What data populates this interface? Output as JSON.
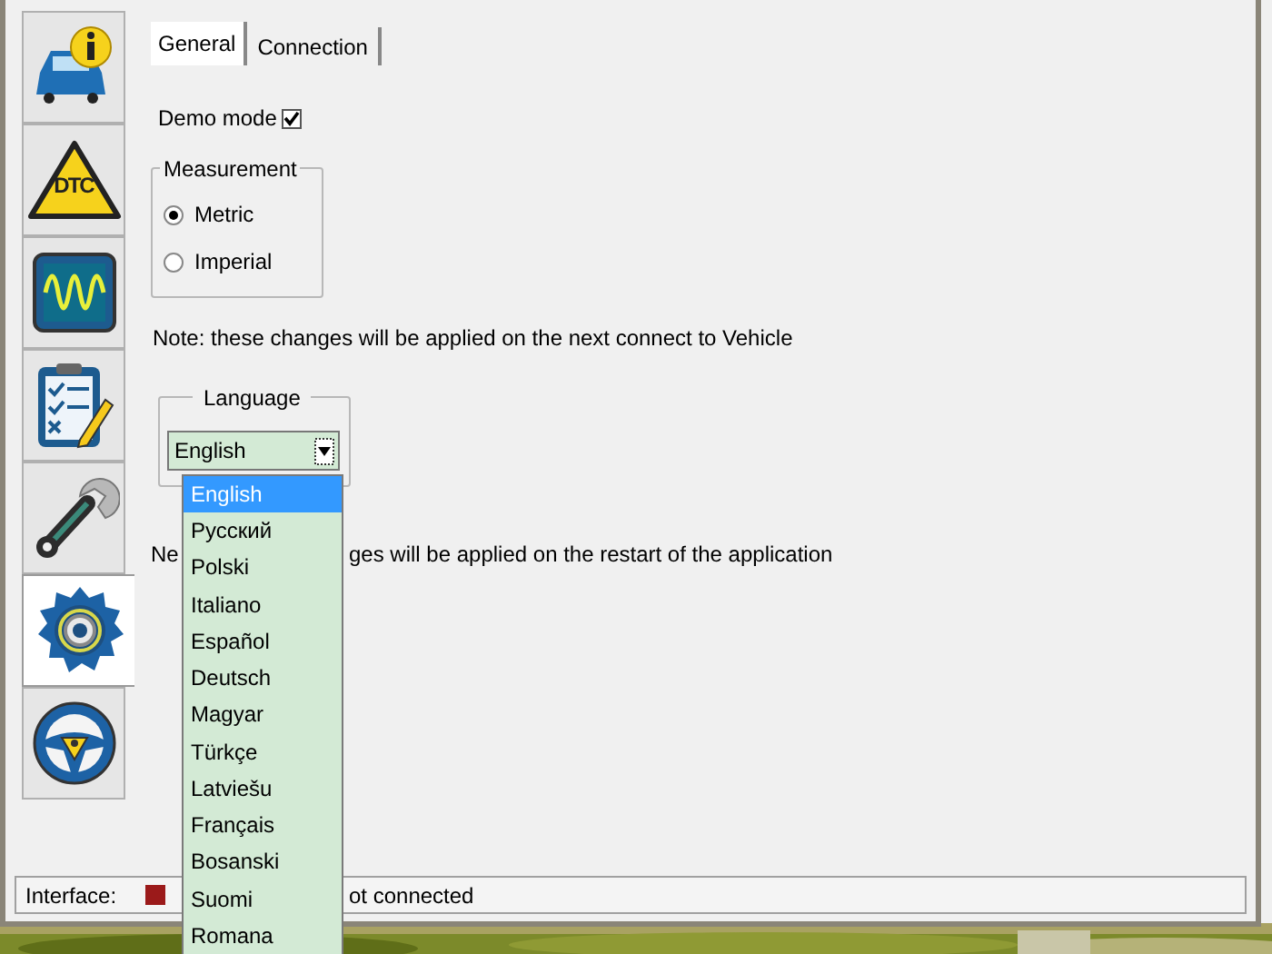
{
  "sidebar": {
    "items": [
      {
        "kind": "vehicle-info",
        "selected": false
      },
      {
        "kind": "dtc",
        "label": "DTC",
        "selected": false
      },
      {
        "kind": "oscilloscope",
        "selected": false
      },
      {
        "kind": "checklist",
        "selected": false
      },
      {
        "kind": "service",
        "selected": false
      },
      {
        "kind": "settings",
        "selected": true
      },
      {
        "kind": "help",
        "selected": false
      }
    ]
  },
  "tabs": [
    {
      "label": "General",
      "selected": true
    },
    {
      "label": "Connection",
      "selected": false
    }
  ],
  "demo_mode": {
    "label": "Demo mode",
    "checked": true
  },
  "measurement": {
    "title": "Measurement",
    "options": [
      {
        "label": "Metric",
        "selected": true
      },
      {
        "label": "Imperial",
        "selected": false
      }
    ]
  },
  "note_1": "Note: these changes will be applied on the next connect to Vehicle",
  "language": {
    "title": "Language",
    "value": "English",
    "options": [
      {
        "label": "English",
        "selected": true
      },
      {
        "label": "Русский",
        "selected": false
      },
      {
        "label": "Polski",
        "selected": false
      },
      {
        "label": "Italiano",
        "selected": false
      },
      {
        "label": "Español",
        "selected": false
      },
      {
        "label": "Deutsch",
        "selected": false
      },
      {
        "label": "Magyar",
        "selected": false
      },
      {
        "label": "Türkçe",
        "selected": false
      },
      {
        "label": "Latviešu",
        "selected": false
      },
      {
        "label": "Français",
        "selected": false
      },
      {
        "label": "Bosanski",
        "selected": false
      },
      {
        "label": "Suomi",
        "selected": false
      },
      {
        "label": "Romana",
        "selected": false
      }
    ]
  },
  "note_2": {
    "start": "Ne",
    "end": "ges will be applied on the restart of the application"
  },
  "status_bar": {
    "label": "Interface:",
    "indicator": {
      "color": "#9b1a1a"
    },
    "status_text": "ot connected"
  }
}
